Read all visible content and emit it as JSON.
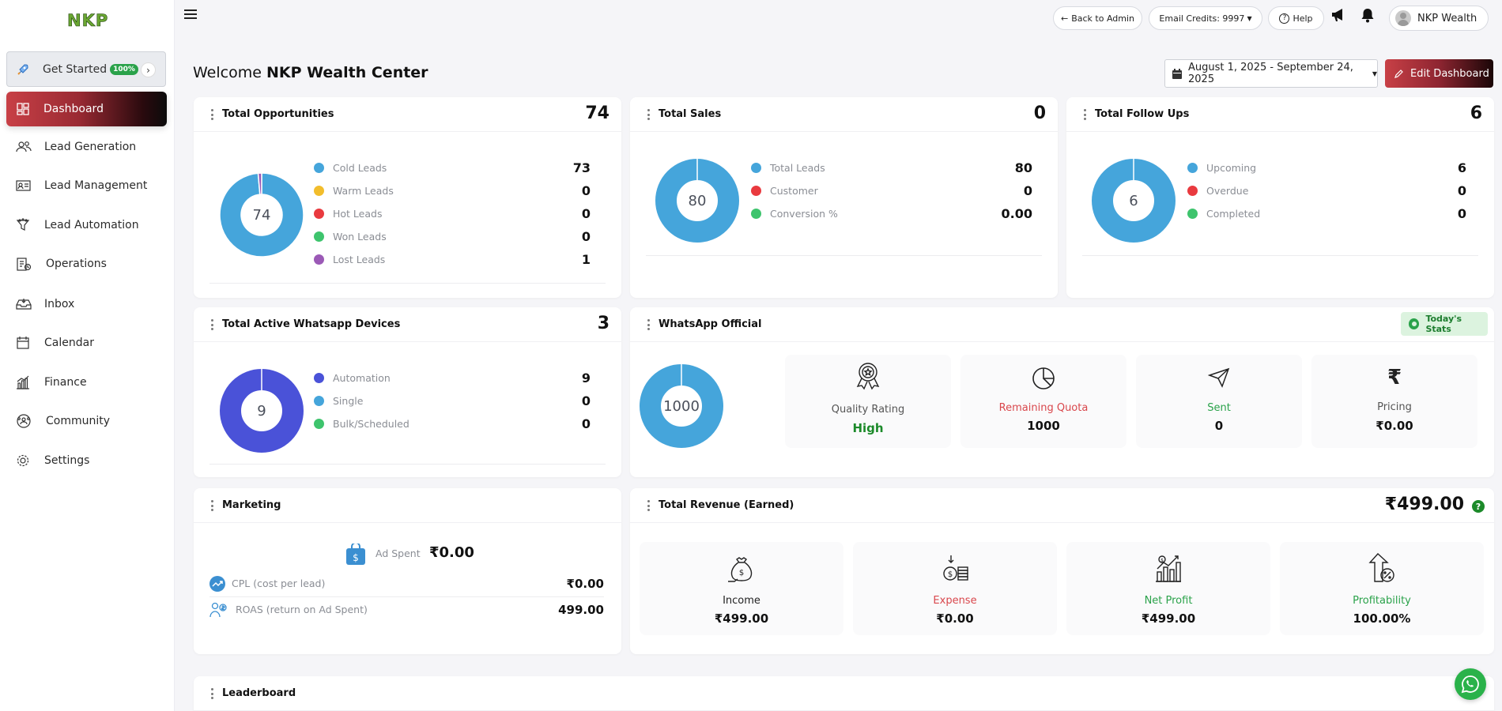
{
  "app": {
    "logo": "NKP"
  },
  "sidebar": {
    "get_started": {
      "label": "Get Started",
      "badge": "100%"
    },
    "active": {
      "label": "Dashboard"
    },
    "items": [
      {
        "label": "Lead Generation",
        "icon": "users-icon"
      },
      {
        "label": "Lead Management",
        "icon": "id-card-icon"
      },
      {
        "label": "Lead Automation",
        "icon": "funnel-icon"
      },
      {
        "label": "Operations",
        "icon": "clipboard-icon"
      },
      {
        "label": "Inbox",
        "icon": "inbox-icon"
      },
      {
        "label": "Calendar",
        "icon": "calendar-icon"
      },
      {
        "label": "Finance",
        "icon": "bar-chart-icon"
      },
      {
        "label": "Community",
        "icon": "community-icon"
      },
      {
        "label": "Settings",
        "icon": "gear-icon"
      }
    ]
  },
  "topbar": {
    "back_to_admin": "Back to Admin",
    "email_credits": "Email Credits: 9997",
    "help": "Help",
    "user_name": "NKP Wealth"
  },
  "header": {
    "welcome_prefix": "Welcome",
    "org_name": "NKP Wealth Center",
    "date_range": "August 1, 2025 - September 24, 2025",
    "edit_dashboard": "Edit Dashboard"
  },
  "colors": {
    "blue": "#45a5db",
    "yellow": "#f2bd2c",
    "red": "#e93a3f",
    "green": "#3ec46d",
    "purple": "#9b59b6",
    "indigo": "#4a52d8",
    "accent_red": "#c84046"
  },
  "cards": {
    "opportunities": {
      "title": "Total Opportunities",
      "total": "74",
      "center": "74",
      "legend": [
        {
          "label": "Cold Leads",
          "value": "73",
          "color": "#45a5db",
          "num": 73
        },
        {
          "label": "Warm Leads",
          "value": "0",
          "color": "#f2bd2c",
          "num": 0
        },
        {
          "label": "Hot Leads",
          "value": "0",
          "color": "#e93a3f",
          "num": 0
        },
        {
          "label": "Won Leads",
          "value": "0",
          "color": "#3ec46d",
          "num": 0
        },
        {
          "label": "Lost Leads",
          "value": "1",
          "color": "#9b59b6",
          "num": 1
        }
      ]
    },
    "sales": {
      "title": "Total Sales",
      "total": "0",
      "center": "80",
      "legend": [
        {
          "label": "Total Leads",
          "value": "80",
          "color": "#45a5db",
          "num": 80
        },
        {
          "label": "Customer",
          "value": "0",
          "color": "#e93a3f",
          "num": 0
        },
        {
          "label": "Conversion %",
          "value": "0.00",
          "color": "#3ec46d",
          "num": 0
        }
      ]
    },
    "followups": {
      "title": "Total Follow Ups",
      "total": "6",
      "center": "6",
      "legend": [
        {
          "label": "Upcoming",
          "value": "6",
          "color": "#45a5db",
          "num": 6
        },
        {
          "label": "Overdue",
          "value": "0",
          "color": "#e93a3f",
          "num": 0
        },
        {
          "label": "Completed",
          "value": "0",
          "color": "#3ec46d",
          "num": 0
        }
      ]
    },
    "whatsapp_devices": {
      "title": "Total Active Whatsapp Devices",
      "total": "3",
      "center": "9",
      "legend": [
        {
          "label": "Automation",
          "value": "9",
          "color": "#4a52d8",
          "num": 9
        },
        {
          "label": "Single",
          "value": "0",
          "color": "#45a5db",
          "num": 0
        },
        {
          "label": "Bulk/Scheduled",
          "value": "0",
          "color": "#3ec46d",
          "num": 0
        }
      ]
    },
    "whatsapp_official": {
      "title": "WhatsApp Official",
      "badge": "Today's Stats",
      "center": "1000",
      "stats": [
        {
          "label": "Quality Rating",
          "value": "High",
          "icon": "award-icon",
          "label_color": "#555",
          "value_color": "#1c8a2a"
        },
        {
          "label": "Remaining Quota",
          "value": "1000",
          "icon": "pie-chart-icon",
          "label_color": "#d9474c",
          "value_color": "#111"
        },
        {
          "label": "Sent",
          "value": "0",
          "icon": "send-icon",
          "label_color": "#2aa24a",
          "value_color": "#111"
        },
        {
          "label": "Pricing",
          "value": "₹0.00",
          "icon": "rupee-icon",
          "label_color": "#555",
          "value_color": "#111"
        }
      ]
    },
    "marketing": {
      "title": "Marketing",
      "ad_spent_label": "Ad Spent",
      "ad_spent_value": "₹0.00",
      "cpl_label": "CPL (cost per lead)",
      "cpl_value": "₹0.00",
      "roas_label": "ROAS (return on Ad Spent)",
      "roas_value": "499.00"
    },
    "revenue": {
      "title": "Total Revenue (Earned)",
      "total": "₹499.00",
      "stats": [
        {
          "label": "Income",
          "value": "₹499.00",
          "icon": "money-bag-icon",
          "label_color": "#222"
        },
        {
          "label": "Expense",
          "value": "₹0.00",
          "icon": "coins-icon",
          "label_color": "#d9474c"
        },
        {
          "label": "Net Profit",
          "value": "₹499.00",
          "icon": "growth-chart-icon",
          "label_color": "#2aa24a"
        },
        {
          "label": "Profitability",
          "value": "100.00%",
          "icon": "percent-arrow-icon",
          "label_color": "#2aa24a"
        }
      ]
    },
    "leaderboard": {
      "title": "Leaderboard"
    }
  }
}
